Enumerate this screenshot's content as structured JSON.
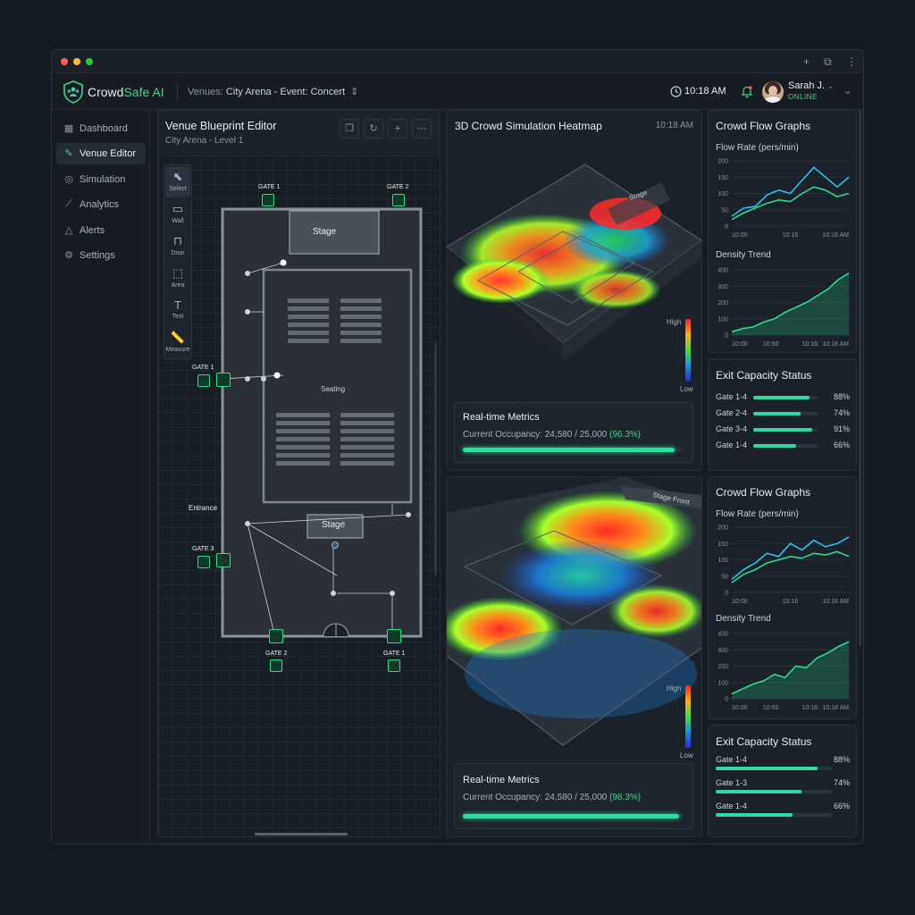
{
  "app": {
    "name_prefix": "Crowd",
    "name_suffix": "Safe AI",
    "context_label": "Venues:",
    "context_value": "City Arena - Event: Concert",
    "time": "10:18 AM",
    "user_name": "Sarah J.",
    "user_status": "ONLINE"
  },
  "sidebar": {
    "items": [
      {
        "label": "Dashboard",
        "icon": "grid-icon"
      },
      {
        "label": "Venue Editor",
        "icon": "pencil-icon"
      },
      {
        "label": "Simulation",
        "icon": "simulation-icon"
      },
      {
        "label": "Analytics",
        "icon": "chart-icon"
      },
      {
        "label": "Alerts",
        "icon": "warning-icon"
      },
      {
        "label": "Settings",
        "icon": "gear-icon"
      }
    ]
  },
  "editor": {
    "title": "Venue Blueprint Editor",
    "subtitle": "City Arena - Level 1",
    "tools": [
      {
        "label": "Select",
        "icon": "cursor-icon"
      },
      {
        "label": "Wall",
        "icon": "wall-icon"
      },
      {
        "label": "Door",
        "icon": "door-icon"
      },
      {
        "label": "Area",
        "icon": "area-icon"
      },
      {
        "label": "Text",
        "icon": "text-icon"
      },
      {
        "label": "Measure",
        "icon": "ruler-icon"
      }
    ],
    "labels": {
      "gate1_top": "GATE 1",
      "gate2_top": "GATE 2",
      "gate1_left": "GATE 1",
      "gate3_left": "GATE 3",
      "gate2_bottom": "GATE 2",
      "gate1_bottom": "GATE 1",
      "stage_top": "Stage",
      "seating": "Seating",
      "stage_bottom": "Stage",
      "entrance": "Entrance"
    }
  },
  "heatmap": {
    "title": "3D Crowd Simulation Heatmap",
    "time": "10:18 AM",
    "scene1_sign": "Stage",
    "scene2_sign": "Stage Front",
    "legend_high": "High",
    "legend_low": "Low",
    "metrics": [
      {
        "title": "Real-time Metrics",
        "label": "Current Occupancy: 24,580 / 25,000",
        "pct_text": "(96.3%)",
        "fill": 0.963
      },
      {
        "title": "Real-time Metrics",
        "label": "Current Occupancy: 24,580 / 25,000",
        "pct_text": "(98.3%)",
        "fill": 0.983
      }
    ]
  },
  "right_panels": {
    "flow_1": {
      "title": "Crowd Flow Graphs",
      "flow_label": "Flow Rate (pers/min)",
      "density_label": "Density Trend"
    },
    "capacity_1": {
      "title": "Exit Capacity Status",
      "rows": [
        {
          "label": "Gate 1-4",
          "value": 88,
          "text": "88%"
        },
        {
          "label": "Gate 2-4",
          "value": 74,
          "text": "74%"
        },
        {
          "label": "Gate 3-4",
          "value": 91,
          "text": "91%"
        },
        {
          "label": "Gate 1-4",
          "value": 66,
          "text": "66%"
        }
      ]
    },
    "flow_2": {
      "title": "Crowd Flow Graphs",
      "flow_label": "Flow Rate (pers/min)",
      "density_label": "Density Trend"
    },
    "capacity_2": {
      "title": "Exit Capacity Status",
      "rows": [
        {
          "label": "Gate 1-4",
          "value": 88,
          "text": "88%"
        },
        {
          "label": "Gate 1-3",
          "value": 74,
          "text": "74%"
        },
        {
          "label": "Gate 1-4",
          "value": 66,
          "text": "66%"
        }
      ]
    }
  },
  "chart_data": [
    {
      "type": "line",
      "title": "Flow Rate (pers/min)",
      "x": [
        "10:00",
        "10:16",
        "10:18 AM"
      ],
      "ylim": [
        0,
        200
      ],
      "yticks": [
        0,
        50,
        100,
        150,
        200
      ],
      "series": [
        {
          "values": [
            30,
            55,
            60,
            95,
            110,
            100,
            140,
            180,
            150,
            120,
            150
          ]
        },
        {
          "values": [
            20,
            40,
            55,
            70,
            80,
            75,
            100,
            120,
            110,
            90,
            100
          ]
        }
      ]
    },
    {
      "type": "area",
      "title": "Density Trend",
      "x": [
        "10:00",
        "10:50",
        "10:16",
        "10:18 AM"
      ],
      "ylim": [
        0,
        400
      ],
      "yticks": [
        0,
        100,
        200,
        300,
        400
      ],
      "series": [
        {
          "values": [
            20,
            40,
            50,
            80,
            100,
            140,
            170,
            200,
            240,
            280,
            340,
            380
          ]
        }
      ]
    },
    {
      "type": "line",
      "title": "Flow Rate (pers/min)",
      "x": [
        "10:00",
        "10:16",
        "10:18 AM"
      ],
      "ylim": [
        0,
        200
      ],
      "yticks": [
        0,
        50,
        100,
        150,
        200
      ],
      "series": [
        {
          "values": [
            40,
            70,
            90,
            120,
            110,
            150,
            130,
            160,
            140,
            150,
            170
          ]
        },
        {
          "values": [
            30,
            55,
            70,
            90,
            100,
            110,
            105,
            120,
            115,
            125,
            110
          ]
        }
      ]
    },
    {
      "type": "area",
      "title": "Density Trend",
      "x": [
        "10:00",
        "10:50",
        "10:16",
        "10:18 AM"
      ],
      "ylim": [
        0,
        400
      ],
      "yticks": [
        0,
        100,
        200,
        300,
        400
      ],
      "series": [
        {
          "values": [
            30,
            60,
            90,
            110,
            150,
            130,
            200,
            190,
            250,
            280,
            320,
            350
          ]
        }
      ]
    },
    {
      "type": "bar",
      "title": "Exit Capacity Status",
      "categories": [
        "Gate 1-4",
        "Gate 2-4",
        "Gate 3-4",
        "Gate 1-4"
      ],
      "values": [
        88,
        74,
        91,
        66
      ],
      "ylim": [
        0,
        100
      ]
    },
    {
      "type": "bar",
      "title": "Exit Capacity Status",
      "categories": [
        "Gate 1-4",
        "Gate 1-3",
        "Gate 1-4"
      ],
      "values": [
        88,
        74,
        66
      ],
      "ylim": [
        0,
        100
      ]
    }
  ]
}
